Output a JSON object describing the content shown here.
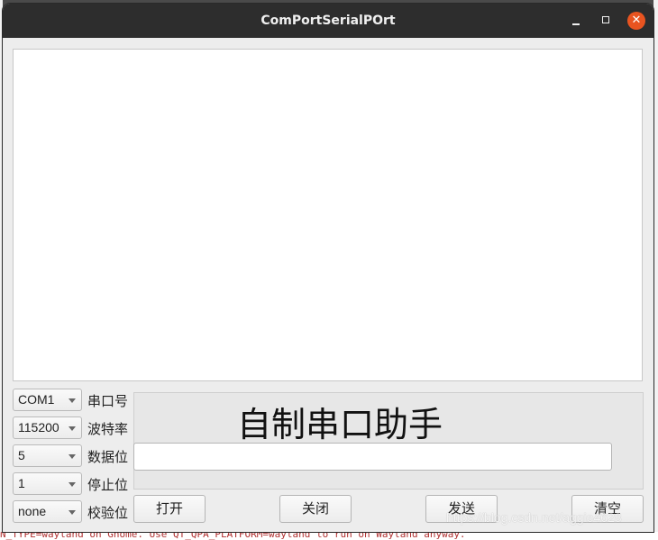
{
  "window": {
    "title": "ComPortSerialPOrt",
    "minimize_symbol": "",
    "maximize_symbol": "",
    "close_symbol": "✕"
  },
  "settings": [
    {
      "value": "COM1",
      "label": "串口号"
    },
    {
      "value": "115200",
      "label": "波特率"
    },
    {
      "value": "5",
      "label": "数据位"
    },
    {
      "value": "1",
      "label": "停止位"
    },
    {
      "value": "none",
      "label": "校验位"
    }
  ],
  "panel": {
    "heading": "自制串口助手",
    "send_input_value": ""
  },
  "buttons": {
    "open": "打开",
    "close": "关闭",
    "send": "发送",
    "clear": "清空"
  },
  "watermark": "https://blog.csdn.net/aggie4628",
  "background_terminal_text": "N_TYPE=wayland on Gnome. Use QT_QPA_PLATFORM=wayland to run on Wayland anyway.",
  "colors": {
    "titlebar": "#2d2d2d",
    "close_button": "#e95420",
    "window_bg": "#ededed"
  }
}
